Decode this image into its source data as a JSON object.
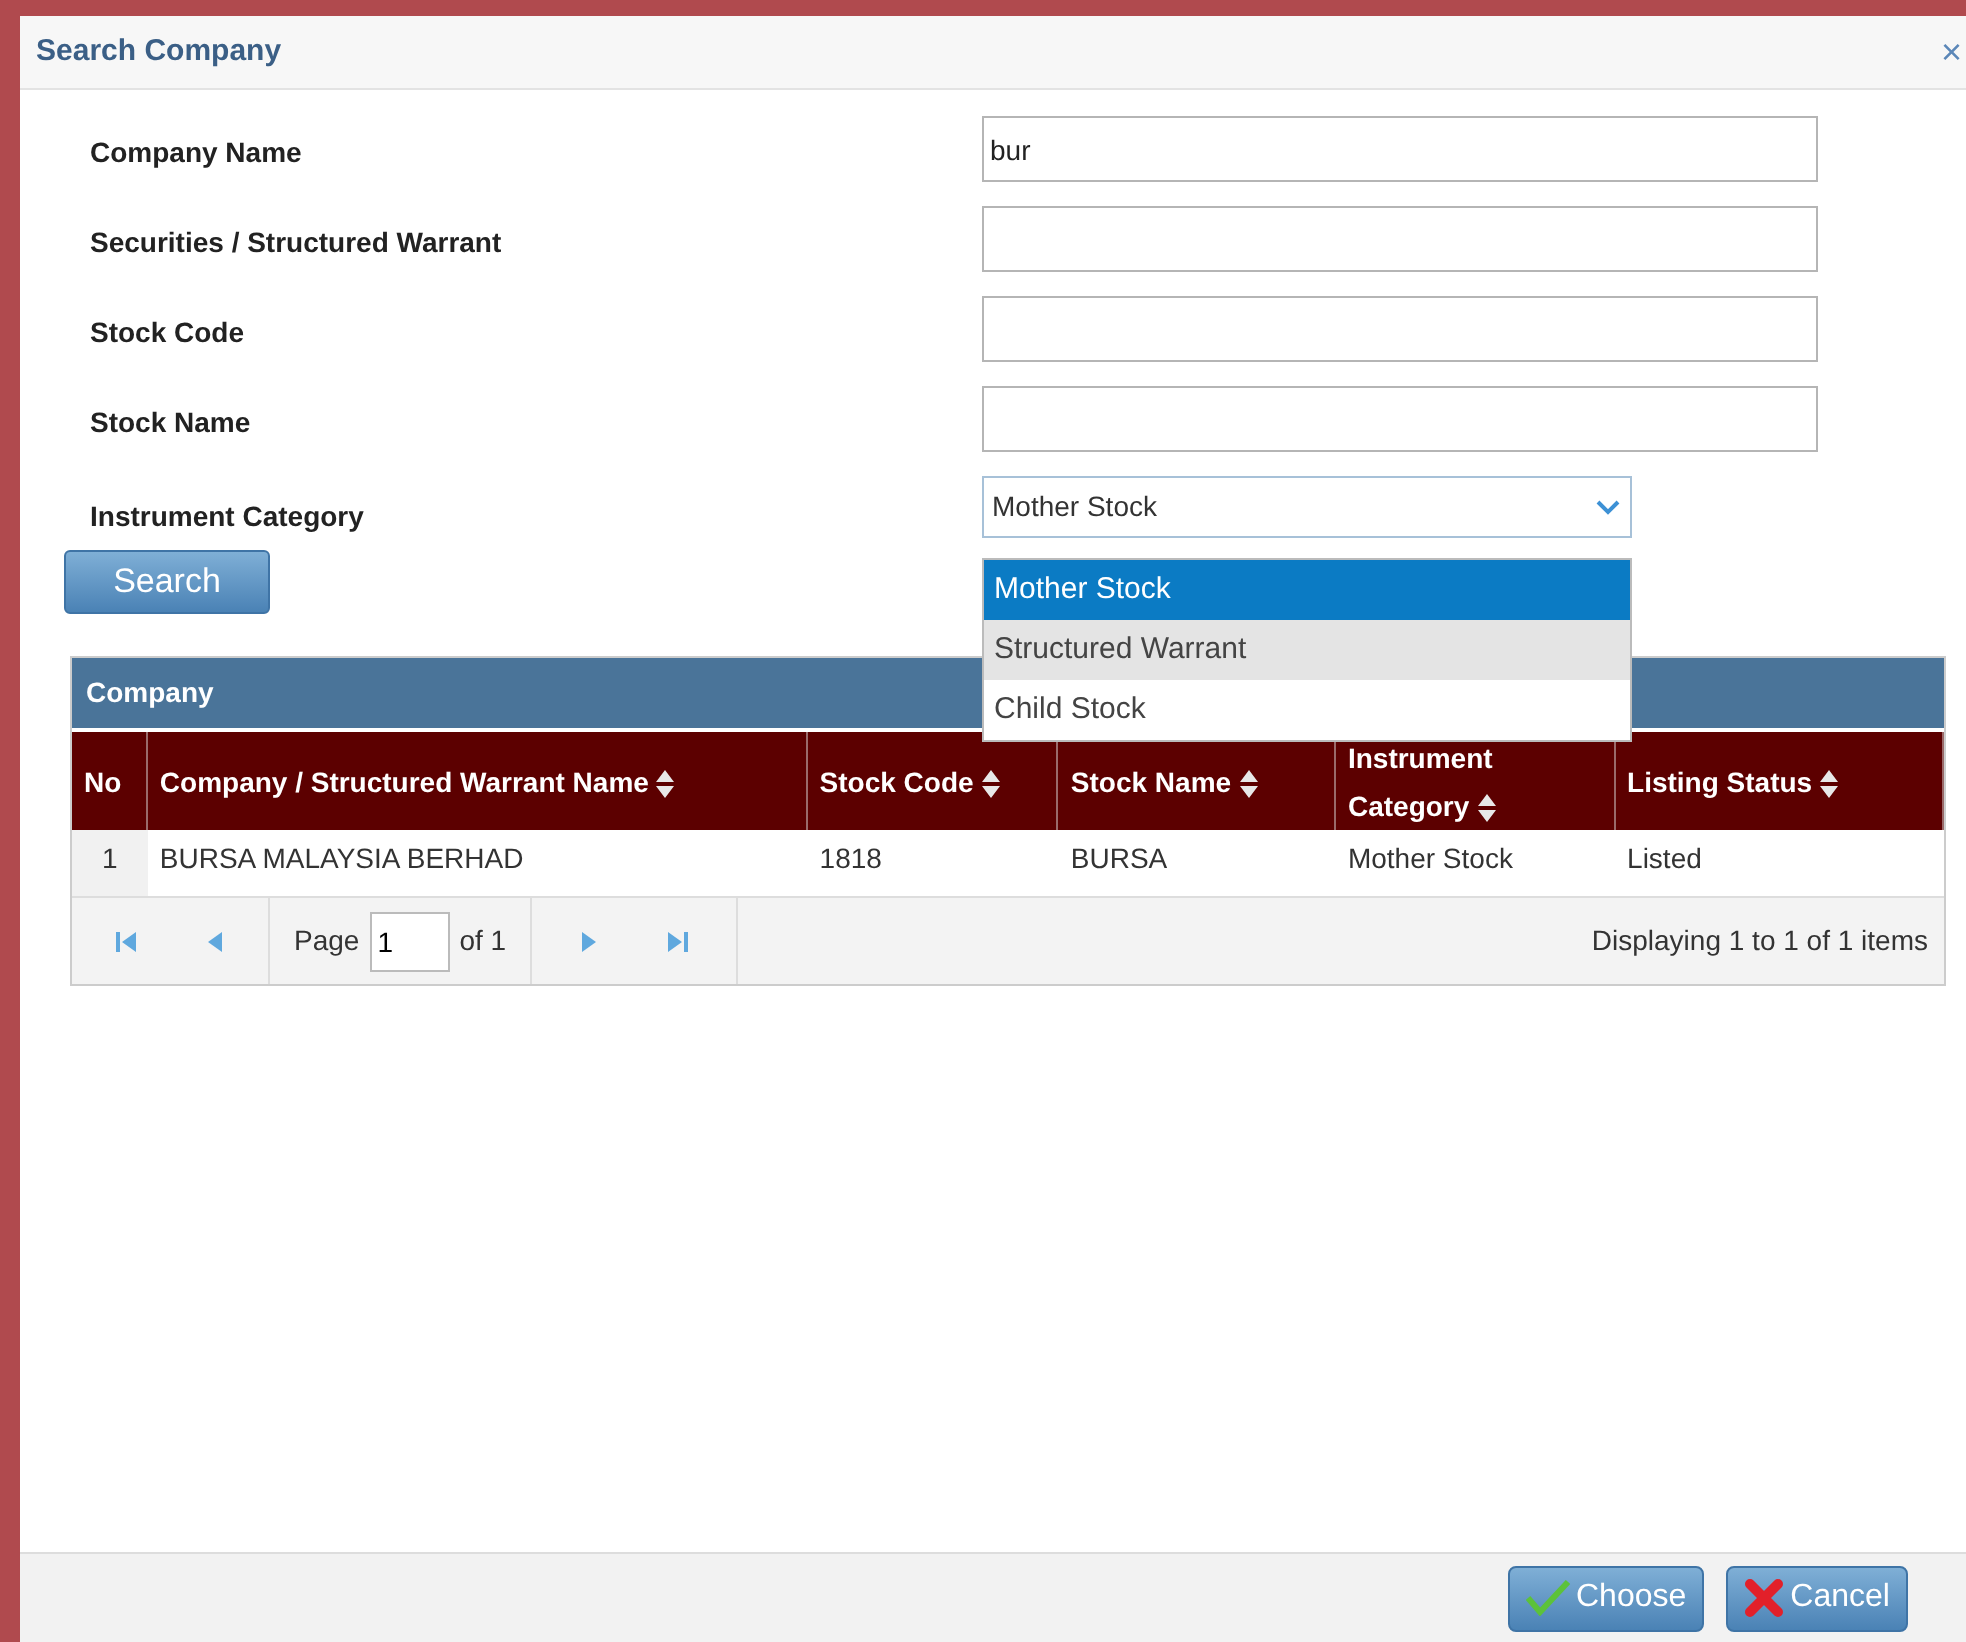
{
  "dialog": {
    "title": "Search Company",
    "close": "×"
  },
  "form": {
    "fields": [
      {
        "label": "Company Name",
        "value": "bur"
      },
      {
        "label": "Securities / Structured Warrant"
      },
      {
        "label": "Stock Code"
      },
      {
        "label": "Stock Name"
      }
    ],
    "category": {
      "label": "Instrument Category",
      "value": "Mother Stock",
      "expanded": true,
      "options": [
        {
          "label": "Mother Stock",
          "selected": true,
          "hovered": false
        },
        {
          "label": "Structured Warrant",
          "selected": false,
          "hovered": true
        },
        {
          "label": "Child Stock",
          "selected": false,
          "hovered": false
        }
      ]
    },
    "search_button": "Search"
  },
  "table": {
    "title": "Company",
    "columns": [
      {
        "label": "No",
        "sortable": false
      },
      {
        "label": "Company / Structured Warrant Name",
        "sortable": true
      },
      {
        "label": "Stock Code",
        "sortable": true
      },
      {
        "label": "Stock Name",
        "sortable": true
      },
      {
        "label": "Instrument Category",
        "sortable": true
      },
      {
        "label": "Listing Status",
        "sortable": true
      }
    ],
    "rows": [
      [
        "1",
        "BURSA MALAYSIA BERHAD",
        "1818",
        "BURSA",
        "Mother Stock",
        "Listed"
      ]
    ]
  },
  "pager": {
    "page_label": "Page",
    "page": "1",
    "of": "of 1",
    "summary": "Displaying 1 to 1 of 1 items"
  },
  "buttons": [
    {
      "kind": "choose",
      "label": "Choose"
    },
    {
      "kind": "cancel",
      "label": "Cancel"
    }
  ]
}
